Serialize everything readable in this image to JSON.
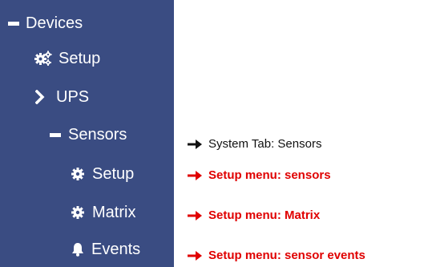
{
  "sidebar": {
    "items": [
      {
        "label": "Devices",
        "icon": "minus-icon"
      },
      {
        "label": "Setup",
        "icon": "gears-icon"
      },
      {
        "label": "UPS",
        "icon": "chevron-right-icon"
      },
      {
        "label": "Sensors",
        "icon": "minus-icon"
      },
      {
        "label": "Setup",
        "icon": "gear-icon"
      },
      {
        "label": "Matrix",
        "icon": "gear-icon"
      },
      {
        "label": "Events",
        "icon": "bell-icon"
      }
    ]
  },
  "annotations": [
    {
      "text": "System Tab: Sensors",
      "color": "#111111"
    },
    {
      "text": "Setup menu: sensors",
      "color": "#e00000"
    },
    {
      "text": "Setup menu: Matrix",
      "color": "#e00000"
    },
    {
      "text": "Setup menu: sensor events",
      "color": "#e00000"
    }
  ],
  "colors": {
    "sidebar_bg": "#3a4c82",
    "sidebar_text": "#ffffff",
    "accent_red": "#e00000"
  }
}
